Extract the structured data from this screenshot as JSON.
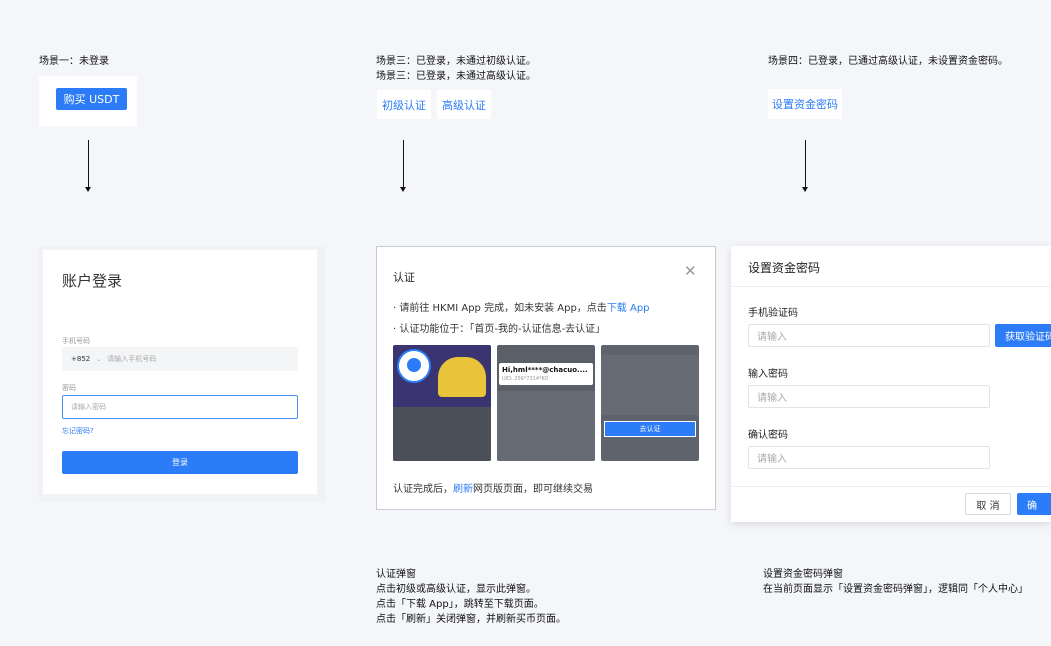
{
  "scene1": {
    "label": "场景一：未登录",
    "buy_button": "购买 USDT"
  },
  "scene3": {
    "label_line1": "场景三：已登录，未通过初级认证。",
    "label_line2": "场景三：已登录，未通过高级认证。",
    "primary_button": "初级认证",
    "advanced_button": "高级认证"
  },
  "scene4": {
    "label": "场景四：已登录，已通过高级认证，未设置资金密码。",
    "set_pwd_button": "设置资金密码"
  },
  "login": {
    "title": "账户登录",
    "phone_label": "手机号码",
    "country_code": "+852",
    "phone_placeholder": "请输入手机号码",
    "pwd_label": "密码",
    "pwd_placeholder": "请输入密码",
    "forgot": "忘记密码?",
    "submit": "登录"
  },
  "verify_modal": {
    "title": "认证",
    "line1_prefix": "· 请前往 HKMI App 完成，如未安装 App，点击",
    "line1_link": "下载 App",
    "line2": "· 认证功能位于：「首页-我的-认证信息-去认证」",
    "shot2_email": "Hi,hml****@chacuo....",
    "shot2_uid": "UID: 256*7314*K0",
    "shot3_button": "去认证",
    "footer_prefix": "认证完成后，",
    "footer_link": "刷新",
    "footer_suffix": "网页版页面，即可继续交易"
  },
  "pwd_modal": {
    "title": "设置资金密码",
    "sms_label": "手机验证码",
    "sms_placeholder": "请输入",
    "get_code": "获取验证码",
    "pwd_label": "输入密码",
    "pwd_placeholder": "请输入",
    "confirm_label": "确认密码",
    "confirm_placeholder": "请输入",
    "cancel": "取 消",
    "ok": "确"
  },
  "notes": {
    "verify_title": "认证弹窗",
    "verify_body": "点击初级或高级认证，显示此弹窗。\n点击「下载 App」，跳转至下载页面。\n点击「刷新」关闭弹窗，并刷新买币页面。",
    "pwd_title": "设置资金密码弹窗",
    "pwd_body": "在当前页面显示「设置资金密码弹窗」，逻辑同「个人中心」"
  },
  "colors": {
    "accent": "#2b7cf6",
    "bg": "#f4f6f9"
  }
}
